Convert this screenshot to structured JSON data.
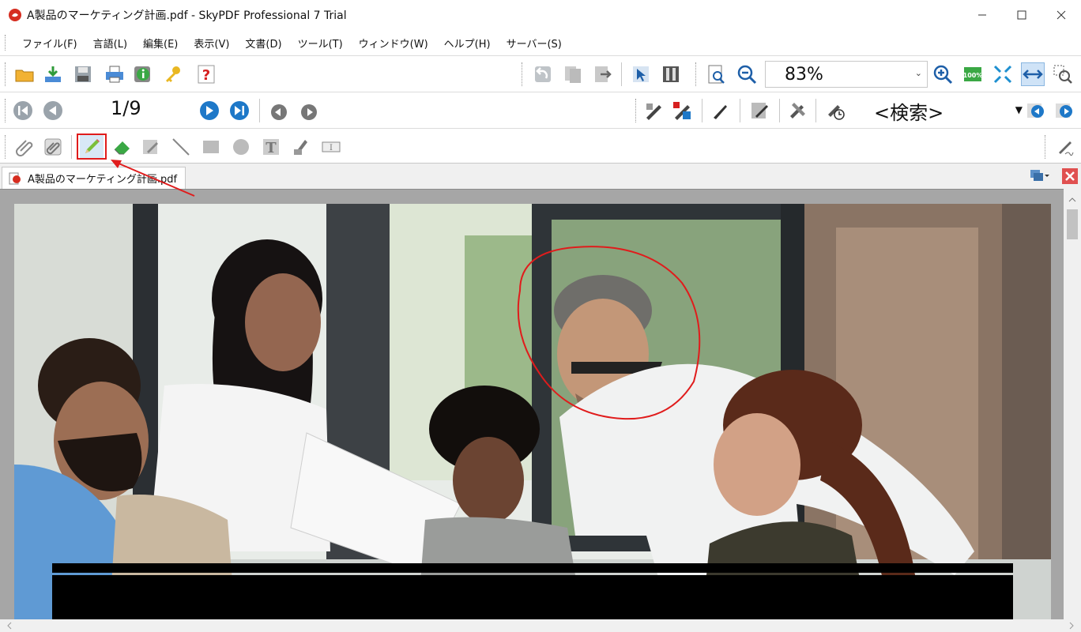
{
  "window": {
    "title": "A製品のマーケティング計画.pdf - SkyPDF Professional 7 Trial",
    "controls": [
      "minimize",
      "maximize",
      "close"
    ]
  },
  "menu": {
    "items": [
      "ファイル(F)",
      "言語(L)",
      "編集(E)",
      "表示(V)",
      "文書(D)",
      "ツール(T)",
      "ウィンドウ(W)",
      "ヘルプ(H)",
      "サーバー(S)"
    ]
  },
  "toolbar": {
    "zoom_value": "83%",
    "page_indicator": "1/9",
    "search_placeholder": "<検索>"
  },
  "document": {
    "tab_label": "A製品のマーケティング計画.pdf",
    "content": "photo-of-business-meeting-with-hand-drawn-circle-annotation"
  },
  "annotation": {
    "highlight_color": "#e01c1c",
    "highlighted_tool": "pencil-tool"
  }
}
